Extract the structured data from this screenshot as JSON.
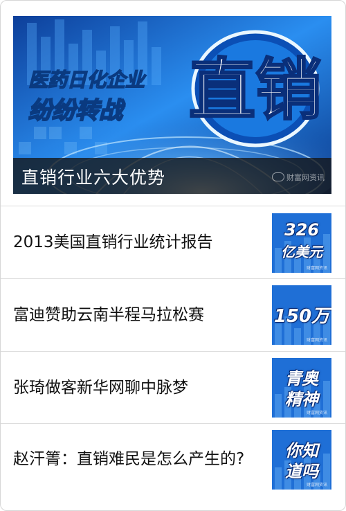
{
  "hero": {
    "image": {
      "headline_icon_text": "直销",
      "subline_text": "医药日化企业",
      "subline2_text": "纷纷转战"
    },
    "title": "直销行业六大优势",
    "watermark": "财富网资讯"
  },
  "articles": [
    {
      "title": "2013美国直销行业统计报告",
      "thumb_lines": [
        "326",
        "亿美元"
      ],
      "thumb_watermark": "财富网资讯"
    },
    {
      "title": "富迪赞助云南半程马拉松赛",
      "thumb_lines": [
        "150万"
      ],
      "thumb_watermark": "财富网资讯"
    },
    {
      "title": "张琦做客新华网聊中脉梦",
      "thumb_lines": [
        "青奥",
        "精神"
      ],
      "thumb_watermark": "财富网资讯"
    },
    {
      "title": "赵汗箐：直销难民是怎么产生的?",
      "thumb_lines": [
        "你知",
        "道吗"
      ],
      "thumb_watermark": "财富网资讯"
    }
  ],
  "colors": {
    "thumb_bg": "#1f6fd6",
    "hero_bg": "#1a63c4",
    "divider": "#dcdcdc",
    "text": "#111111"
  }
}
